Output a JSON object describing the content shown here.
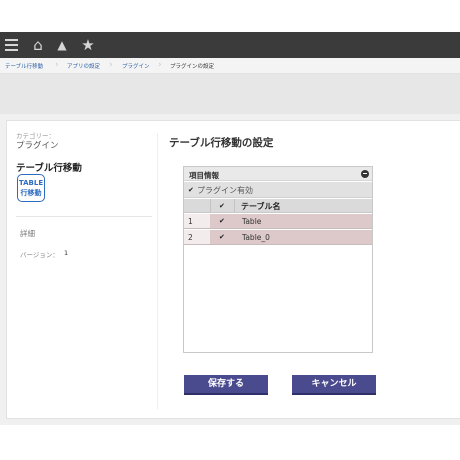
{
  "topbar": {
    "icons": [
      "menu-icon",
      "home-icon",
      "bell-icon",
      "star-icon"
    ],
    "home_glyph": "⌂",
    "bell_glyph": "▲",
    "star_glyph": "★"
  },
  "breadcrumb": {
    "items": [
      "テーブル行移動",
      "アプリの設定",
      "プラグイン",
      "プラグインの設定"
    ]
  },
  "sidebar": {
    "category_label": "カテゴリー：",
    "category_value": "プラグイン",
    "plugin_name": "テーブル行移動",
    "logo_line1": "TABLE",
    "logo_line2": "行移動",
    "detail_link": "詳細",
    "version_label": "バージョン：",
    "version_value": "1"
  },
  "main": {
    "title": "テーブル行移動の設定",
    "table": {
      "header": "項目情報",
      "enable_check": "✔",
      "enable_label": "プラグイン有効",
      "column_check": "✔",
      "column_name": "テーブル名",
      "rows": [
        {
          "num": "1",
          "check": "✔",
          "name": "Table"
        },
        {
          "num": "2",
          "check": "✔",
          "name": "Table_0"
        }
      ]
    },
    "save_label": "保存する",
    "cancel_label": "キャンセル"
  },
  "colors": {
    "topbar": "#3b3b3b",
    "button": "#4a4a8f",
    "row_highlight": "#ddc9c9",
    "link": "#2a5fa8"
  }
}
